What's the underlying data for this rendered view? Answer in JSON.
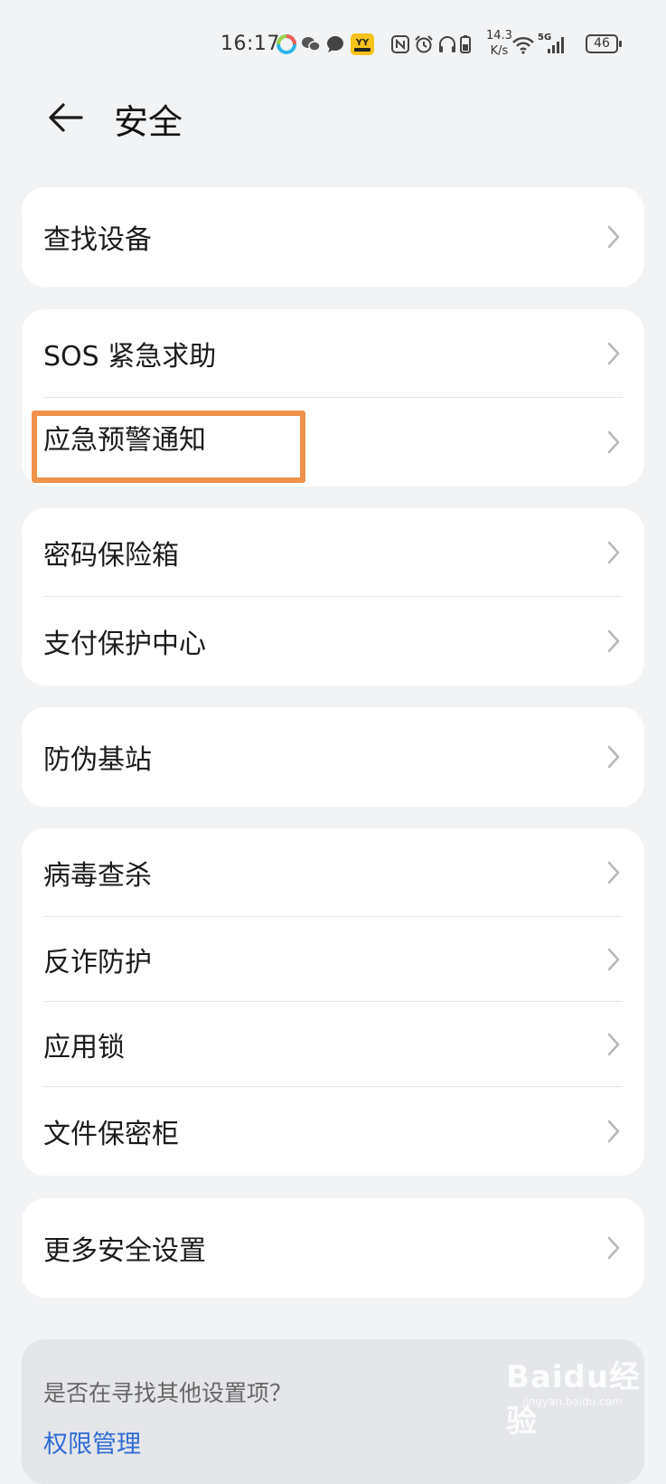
{
  "status_bar": {
    "time": "16:17",
    "speed_value": "14.3",
    "speed_unit": "K/s",
    "network": "5G",
    "battery": "46"
  },
  "header": {
    "title": "安全"
  },
  "groups": [
    {
      "items": [
        {
          "label": "查找设备"
        }
      ]
    },
    {
      "items": [
        {
          "label": "SOS 紧急求助"
        },
        {
          "label": "应急预警通知"
        }
      ]
    },
    {
      "items": [
        {
          "label": "密码保险箱"
        },
        {
          "label": "支付保护中心"
        }
      ]
    },
    {
      "items": [
        {
          "label": "防伪基站"
        }
      ]
    },
    {
      "items": [
        {
          "label": "病毒查杀"
        },
        {
          "label": "反诈防护"
        },
        {
          "label": "应用锁"
        },
        {
          "label": "文件保密柜"
        }
      ]
    },
    {
      "items": [
        {
          "label": "更多安全设置"
        }
      ]
    }
  ],
  "suggestions": {
    "question": "是否在寻找其他设置项？",
    "link": "权限管理"
  },
  "watermark": {
    "brand": "Baidu经验",
    "url": "jingyan.baidu.com"
  },
  "colors": {
    "background": "#f1f3f5",
    "card": "#ffffff",
    "highlight_border": "#f0924a",
    "link": "#2f6cd4"
  }
}
